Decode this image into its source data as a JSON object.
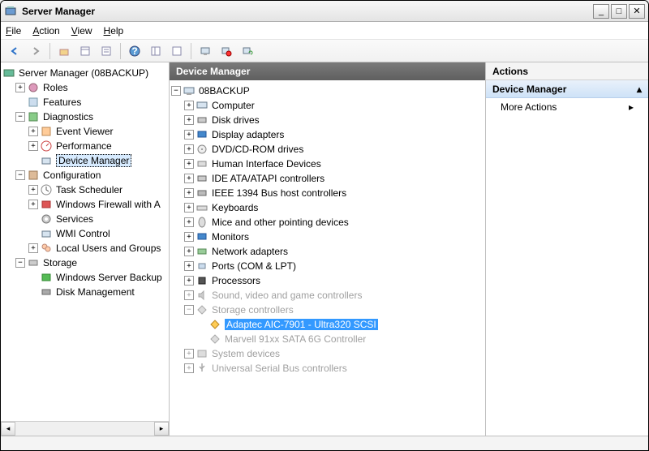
{
  "window": {
    "title": "Server Manager"
  },
  "menu": {
    "file": "File",
    "action": "Action",
    "view": "View",
    "help": "Help"
  },
  "left_pane": {
    "root": "Server Manager (08BACKUP)",
    "roles": "Roles",
    "features": "Features",
    "diagnostics": "Diagnostics",
    "event_viewer": "Event Viewer",
    "performance": "Performance",
    "device_manager": "Device Manager",
    "configuration": "Configuration",
    "task_scheduler": "Task Scheduler",
    "windows_firewall": "Windows Firewall with A",
    "services": "Services",
    "wmi_control": "WMI Control",
    "local_users": "Local Users and Groups",
    "storage": "Storage",
    "win_server_backup": "Windows Server Backup",
    "disk_management": "Disk Management"
  },
  "center_pane": {
    "header": "Device Manager",
    "root": "08BACKUP",
    "computer": "Computer",
    "disk_drives": "Disk drives",
    "display_adapters": "Display adapters",
    "dvd": "DVD/CD-ROM drives",
    "hid": "Human Interface Devices",
    "ide": "IDE ATA/ATAPI controllers",
    "ieee1394": "IEEE 1394 Bus host controllers",
    "keyboards": "Keyboards",
    "mice": "Mice and other pointing devices",
    "monitors": "Monitors",
    "network": "Network adapters",
    "ports": "Ports (COM & LPT)",
    "processors": "Processors",
    "sound": "Sound, video and game controllers",
    "storage_ctrl": "Storage controllers",
    "adaptec": "Adaptec AIC-7901 - Ultra320 SCSI",
    "marvell": "Marvell 91xx SATA 6G Controller",
    "system_devices": "System devices",
    "usb": "Universal Serial Bus controllers"
  },
  "right_pane": {
    "header": "Actions",
    "subheader": "Device Manager",
    "more_actions": "More Actions"
  }
}
